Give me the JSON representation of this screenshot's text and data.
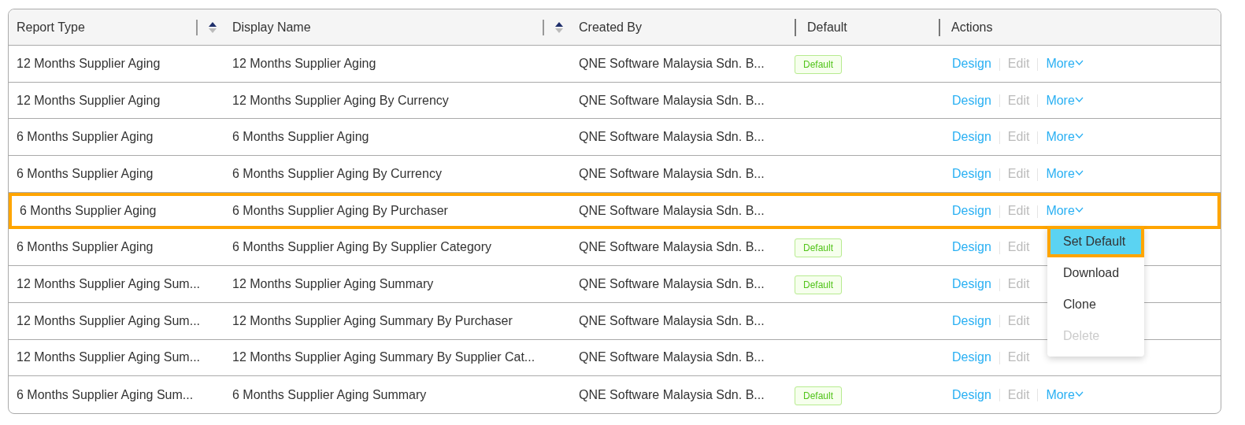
{
  "table": {
    "columns": [
      {
        "label": "Report Type",
        "sortable": true
      },
      {
        "label": "Display Name",
        "sortable": true
      },
      {
        "label": "Created By",
        "sortable": false
      },
      {
        "label": "Default",
        "sortable": false
      },
      {
        "label": "Actions",
        "sortable": false
      }
    ],
    "rows": [
      {
        "report_type": "12 Months Supplier Aging",
        "display_name": "12 Months Supplier Aging",
        "created_by": "QNE Software Malaysia Sdn. B...",
        "default": "Default",
        "highlighted": false,
        "actions": {
          "design": "Design",
          "edit": "Edit",
          "more": "More"
        }
      },
      {
        "report_type": "12 Months Supplier Aging",
        "display_name": "12 Months Supplier Aging By Currency",
        "created_by": "QNE Software Malaysia Sdn. B...",
        "highlighted": false,
        "actions": {
          "design": "Design",
          "edit": "Edit",
          "more": "More"
        }
      },
      {
        "report_type": "6 Months Supplier Aging",
        "display_name": "6 Months Supplier Aging",
        "created_by": "QNE Software Malaysia Sdn. B...",
        "highlighted": false,
        "actions": {
          "design": "Design",
          "edit": "Edit",
          "more": "More"
        }
      },
      {
        "report_type": "6 Months Supplier Aging",
        "display_name": "6 Months Supplier Aging By Currency",
        "created_by": "QNE Software Malaysia Sdn. B...",
        "highlighted": false,
        "actions": {
          "design": "Design",
          "edit": "Edit",
          "more": "More"
        }
      },
      {
        "report_type": "6 Months Supplier Aging",
        "display_name": "6 Months Supplier Aging By Purchaser",
        "created_by": "QNE Software Malaysia Sdn. B...",
        "highlighted": true,
        "actions": {
          "design": "Design",
          "edit": "Edit",
          "more": "More"
        },
        "menu": [
          {
            "label": "Set Default",
            "selected": true,
            "disabled": false
          },
          {
            "label": "Download",
            "selected": false,
            "disabled": false
          },
          {
            "label": "Clone",
            "selected": false,
            "disabled": false
          },
          {
            "label": "Delete",
            "selected": false,
            "disabled": true
          }
        ]
      },
      {
        "report_type": "6 Months Supplier Aging",
        "display_name": "6 Months Supplier Aging By Supplier Category",
        "created_by": "QNE Software Malaysia Sdn. B...",
        "default": "Default",
        "highlighted": false,
        "actions": {
          "design": "Design",
          "edit": "Edit"
        }
      },
      {
        "report_type": "12 Months Supplier Aging Sum...",
        "display_name": "12 Months Supplier Aging Summary",
        "created_by": "QNE Software Malaysia Sdn. B...",
        "default": "Default",
        "highlighted": false,
        "actions": {
          "design": "Design",
          "edit": "Edit"
        }
      },
      {
        "report_type": "12 Months Supplier Aging Sum...",
        "display_name": "12 Months Supplier Aging Summary By Purchaser",
        "created_by": "QNE Software Malaysia Sdn. B...",
        "highlighted": false,
        "actions": {
          "design": "Design",
          "edit": "Edit"
        }
      },
      {
        "report_type": "12 Months Supplier Aging Sum...",
        "display_name": "12 Months Supplier Aging Summary By Supplier Cat...",
        "created_by": "QNE Software Malaysia Sdn. B...",
        "highlighted": false,
        "actions": {
          "design": "Design",
          "edit": "Edit"
        }
      },
      {
        "report_type": "6 Months Supplier Aging Sum...",
        "display_name": "6 Months Supplier Aging Summary",
        "created_by": "QNE Software Malaysia Sdn. B...",
        "default": "Default",
        "highlighted": false,
        "actions": {
          "design": "Design",
          "edit": "Edit",
          "more": "More"
        }
      }
    ]
  }
}
